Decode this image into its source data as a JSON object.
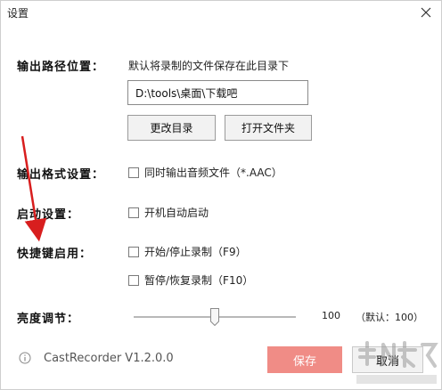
{
  "window": {
    "title": "设置"
  },
  "output_path": {
    "label": "输出路径位置：",
    "hint": "默认将录制的文件保存在此目录下",
    "path_value": "D:\\tools\\桌面\\下载吧",
    "change_dir_label": "更改目录",
    "open_folder_label": "打开文件夹"
  },
  "output_format": {
    "label": "输出格式设置：",
    "option_audio": "同时输出音频文件（*.AAC）",
    "option_audio_checked": false
  },
  "startup": {
    "label": "启动设置：",
    "option_autostart": "开机自动启动",
    "option_autostart_checked": false
  },
  "hotkeys": {
    "label": "快捷键启用：",
    "option_start_stop": "开始/停止录制（F9）",
    "option_start_stop_checked": false,
    "option_pause_resume": "暂停/恢复录制（F10）",
    "option_pause_resume_checked": false
  },
  "brightness": {
    "label": "亮度调节：",
    "value": "100",
    "default_text": "（默认：100）",
    "level_fraction": 0.5
  },
  "footer": {
    "version": "CastRecorder V1.2.0.0",
    "save_label": "保存",
    "cancel_label": "取消"
  },
  "colors": {
    "save_button": "#f08c86",
    "annotation_arrow": "#d81e1e"
  }
}
